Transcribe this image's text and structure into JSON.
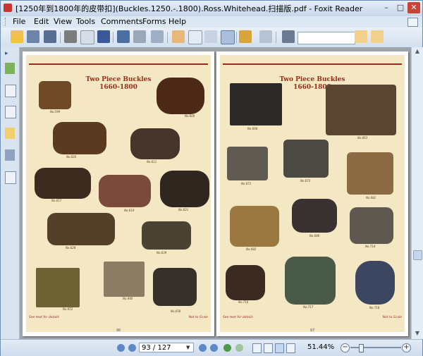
{
  "window": {
    "title": "[1250年到1800年的皮带扣](Buckles.1250.-.1800).Ross.Whitehead.扫描版.pdf - Foxit Reader",
    "minimize": "–",
    "maximize": "□",
    "close": "✕"
  },
  "menu": {
    "items": [
      "File",
      "Edit",
      "View",
      "Tools",
      "Comments",
      "Forms",
      "Help"
    ]
  },
  "toolbar": {
    "search_value": "",
    "icons": [
      "open-icon",
      "save-icon",
      "save-as-icon",
      "print-icon",
      "email-icon",
      "facebook-icon",
      "fullscreen-icon",
      "find-files-icon",
      "snapshot-page-icon",
      "hand-tool-icon",
      "select-arrow-icon",
      "select-text-icon",
      "snapshot-icon",
      "lock-icon",
      "sign-icon",
      "binoculars-icon",
      "find-next-icon",
      "find-prev-icon"
    ]
  },
  "sidebar": {
    "icons": [
      "bookmarks-icon",
      "pages-icon",
      "layers-icon",
      "comments-icon",
      "attachments-icon",
      "signatures-icon"
    ]
  },
  "left_page": {
    "title": "Two Piece Buckles",
    "years": "1660-1800",
    "footer_left": "See text for details",
    "footer_right": "Not to Scale",
    "page_number": "96",
    "labels": [
      "No.599",
      "No.600",
      "No.620",
      "No.611",
      "No.617",
      "No.619",
      "No.621",
      "No.628",
      "No.639",
      "No.640",
      "No.652",
      "No.658"
    ]
  },
  "right_page": {
    "title": "Two Piece Buckles",
    "years": "1660-1800",
    "footer_left": "See text for details",
    "footer_right": "Not to Scale",
    "page_number": "97",
    "labels": [
      "No.664",
      "No.663",
      "No.671",
      "No.672",
      "No.681",
      "No.682",
      "No.686",
      "No.714",
      "No.716",
      "No.717",
      "No.718"
    ]
  },
  "status": {
    "page_field": "93 / 127",
    "zoom": "51.44%"
  }
}
